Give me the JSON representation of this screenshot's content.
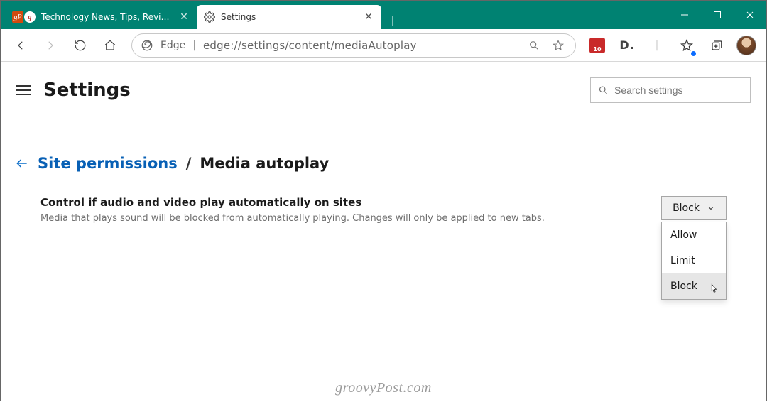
{
  "window": {
    "tabs": [
      {
        "title": "Technology News, Tips, Reviews,",
        "active": false,
        "favicons": [
          "gP",
          "g"
        ]
      },
      {
        "title": "Settings",
        "active": true,
        "favicon": "gear"
      }
    ]
  },
  "toolbar": {
    "browser_label": "Edge",
    "url": "edge://settings/content/mediaAutoplay",
    "extensions": {
      "red_badge": "10",
      "d_label": "D."
    }
  },
  "header": {
    "title": "Settings",
    "search_placeholder": "Search settings"
  },
  "breadcrumb": {
    "parent": "Site permissions",
    "separator": "/",
    "current": "Media autoplay"
  },
  "setting": {
    "title": "Control if audio and video play automatically on sites",
    "description": "Media that plays sound will be blocked from automatically playing. Changes will only be applied to new tabs.",
    "selected": "Block",
    "options": [
      "Allow",
      "Limit",
      "Block"
    ]
  },
  "watermark": "groovyPost.com"
}
